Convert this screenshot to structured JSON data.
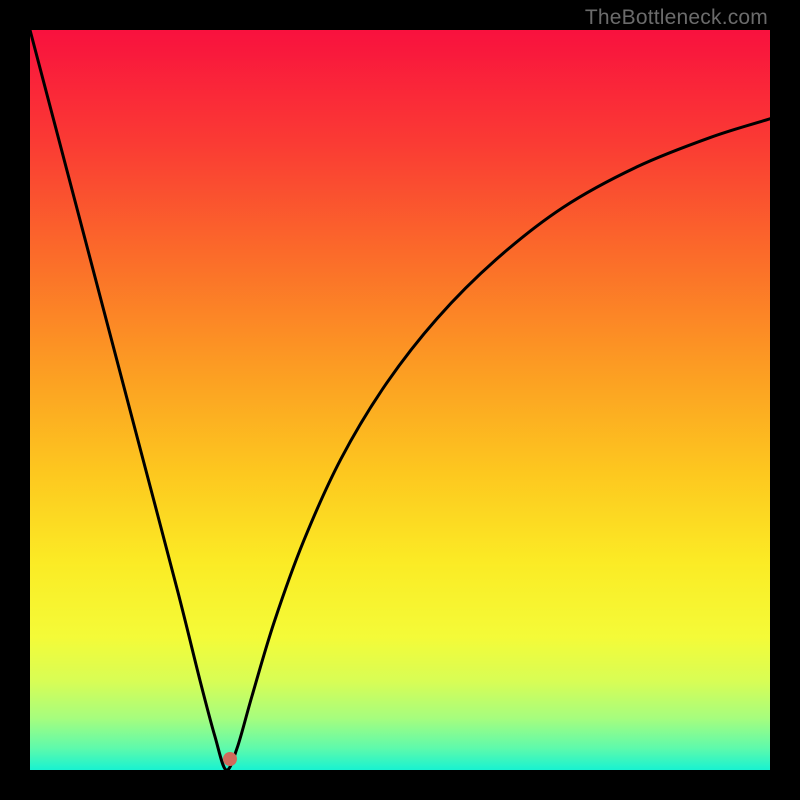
{
  "watermark": "TheBottleneck.com",
  "chart_data": {
    "type": "line",
    "title": "",
    "xlabel": "",
    "ylabel": "",
    "xlim": [
      0,
      100
    ],
    "ylim": [
      0,
      100
    ],
    "grid": false,
    "legend": false,
    "series": [
      {
        "name": "bottleneck-curve",
        "x": [
          0,
          5,
          10,
          15,
          20,
          23,
          25,
          26.5,
          28,
          30,
          33,
          37,
          42,
          48,
          55,
          63,
          72,
          82,
          92,
          100
        ],
        "y": [
          100,
          81,
          62,
          43,
          24,
          12,
          4.5,
          0,
          3,
          10,
          20,
          31,
          42,
          52,
          61,
          69,
          76,
          81.5,
          85.5,
          88
        ]
      }
    ],
    "marker": {
      "x": 27,
      "y": 1.5,
      "color": "#d06a5c"
    },
    "background_gradient": {
      "stops": [
        {
          "offset": 0.0,
          "color": "#f9113e"
        },
        {
          "offset": 0.15,
          "color": "#fa3a34"
        },
        {
          "offset": 0.3,
          "color": "#fb6a2a"
        },
        {
          "offset": 0.45,
          "color": "#fc9a23"
        },
        {
          "offset": 0.6,
          "color": "#fdc81f"
        },
        {
          "offset": 0.72,
          "color": "#fbeb25"
        },
        {
          "offset": 0.82,
          "color": "#f4fb38"
        },
        {
          "offset": 0.88,
          "color": "#d8fd55"
        },
        {
          "offset": 0.93,
          "color": "#a6fd7e"
        },
        {
          "offset": 0.97,
          "color": "#5ffaab"
        },
        {
          "offset": 1.0,
          "color": "#18f2d1"
        }
      ]
    }
  }
}
